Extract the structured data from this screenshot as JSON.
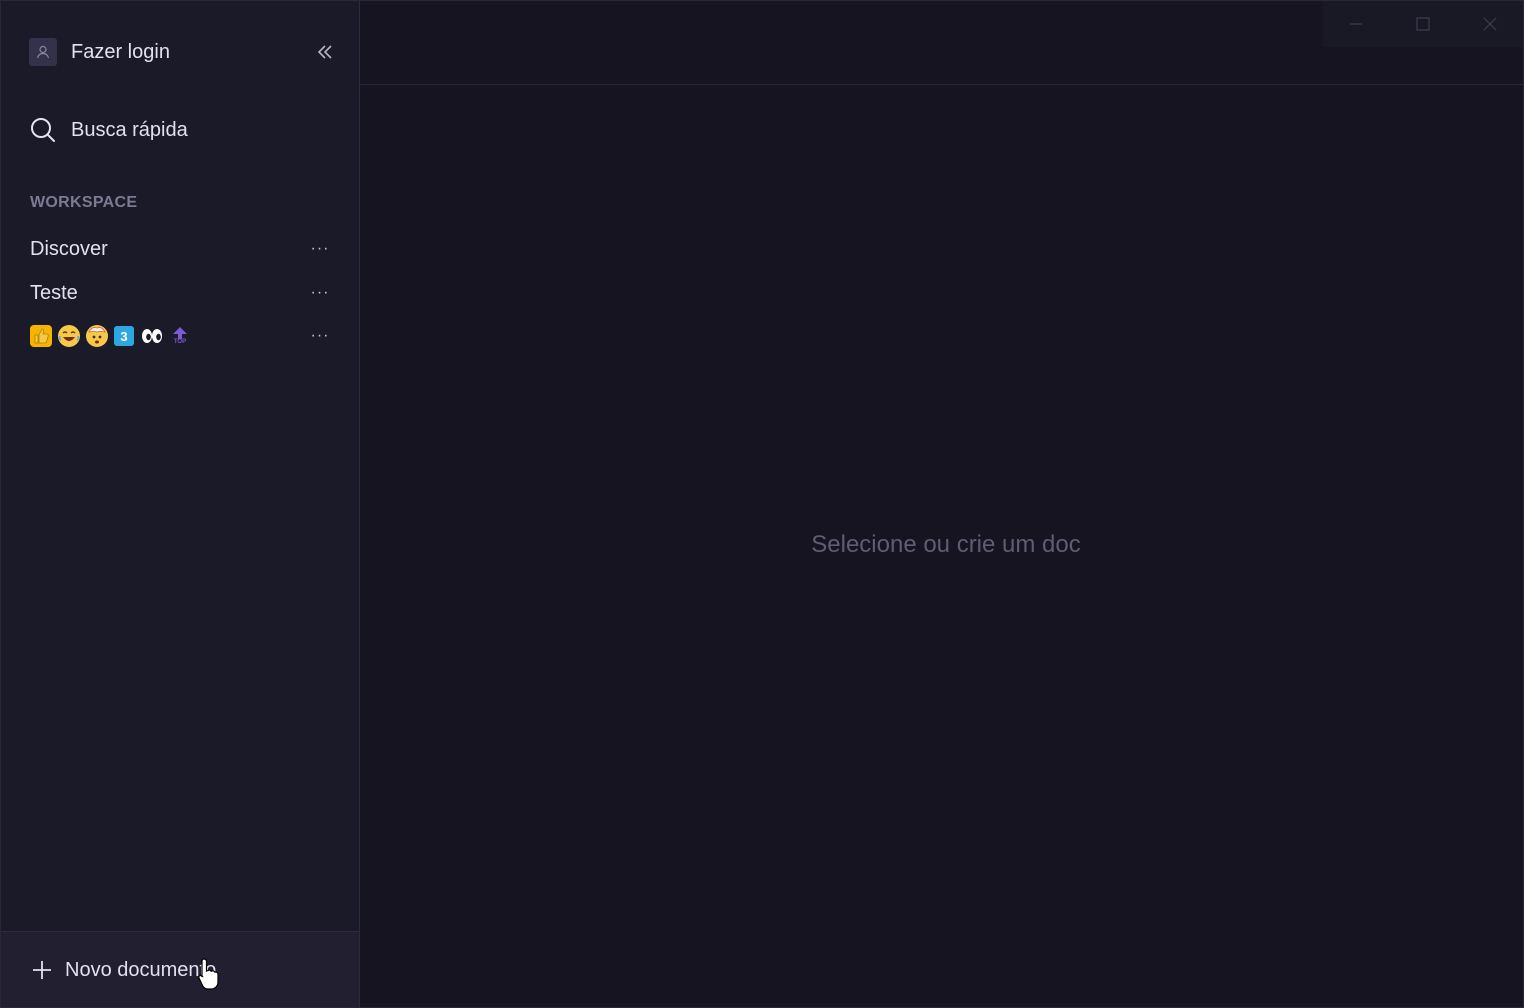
{
  "sidebar": {
    "login_label": "Fazer login",
    "search_label": "Busca rápida",
    "section_title": "WORKSPACE",
    "items": [
      {
        "label": "Discover",
        "more": "···"
      },
      {
        "label": "Teste",
        "more": "···"
      },
      {
        "label": "",
        "more": "···",
        "emojis": [
          "thumbs-up",
          "laughing-face",
          "exploding-head",
          "keycap-3",
          "eyes",
          "top-arrow"
        ],
        "keycap_text": "3",
        "top_text": "TOP"
      }
    ],
    "new_document_label": "Novo documento"
  },
  "main": {
    "empty_message": "Selecione ou crie um doc"
  },
  "colors": {
    "sidebar_bg": "#1b1a28",
    "main_bg": "#151420",
    "text_primary": "#e3e1ee",
    "text_muted": "#7d7a92",
    "empty_text": "#5f5c73"
  }
}
